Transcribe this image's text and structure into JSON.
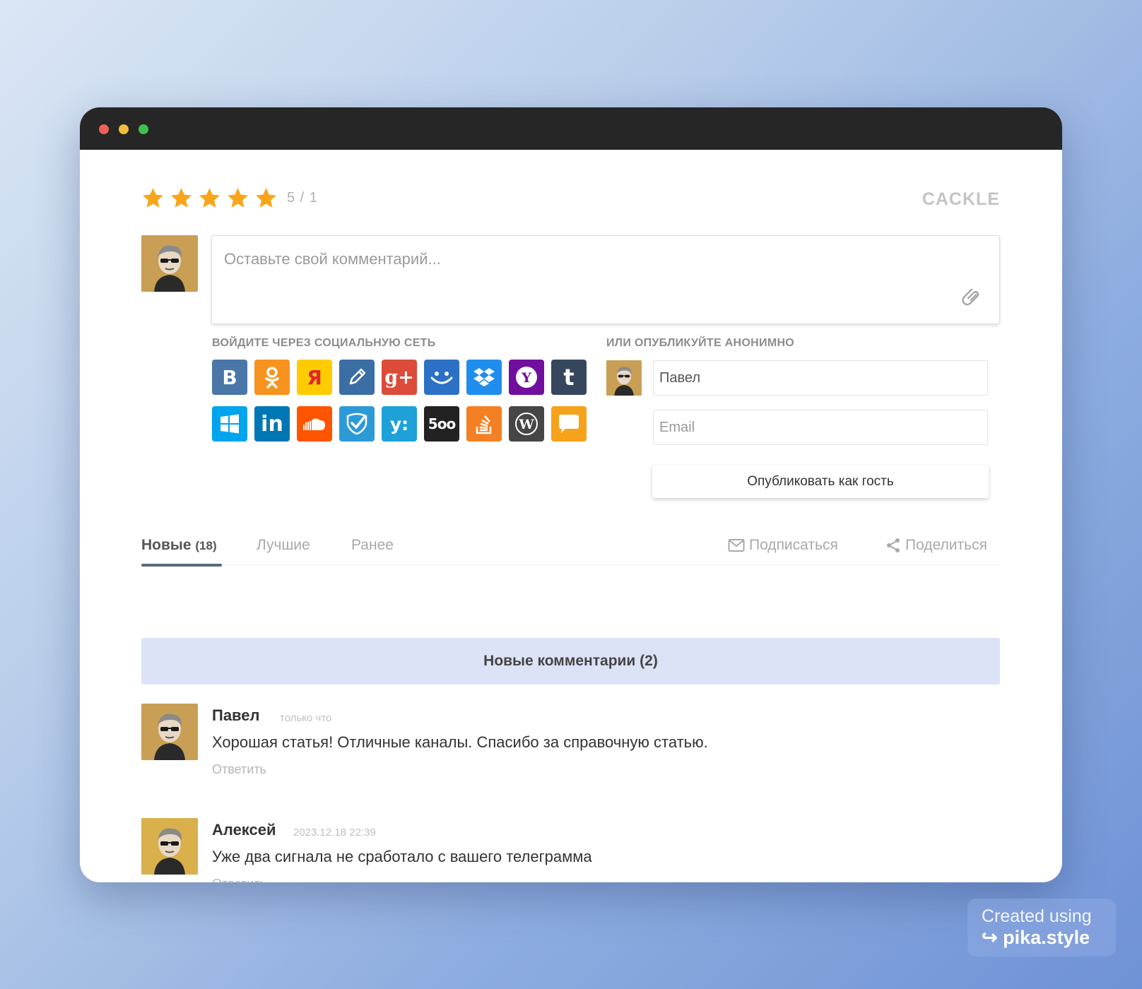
{
  "rating": {
    "stars": 5,
    "max": 5,
    "text": "5 / 1"
  },
  "brand": "CACKLE",
  "comment_box": {
    "placeholder": "Оставьте свой комментарий..."
  },
  "social_login": {
    "label": "ВОЙДИТЕ ЧЕРЕЗ СОЦИАЛЬНУЮ СЕТЬ",
    "networks": [
      {
        "name": "vkontakte",
        "glyph": "B",
        "color": "#4a76a8"
      },
      {
        "name": "odnoklassniki",
        "glyph": "ok",
        "color": "#f7931e"
      },
      {
        "name": "yandex",
        "glyph": "Я",
        "color": "#ffcc00"
      },
      {
        "name": "livejournal",
        "glyph": "pencil",
        "color": "#3b6ea5"
      },
      {
        "name": "google-plus",
        "glyph": "g+",
        "color": "#dd4b39"
      },
      {
        "name": "mail-ru",
        "glyph": "smile",
        "color": "#2d71c6"
      },
      {
        "name": "dropbox",
        "glyph": "box",
        "color": "#1f8ded"
      },
      {
        "name": "yahoo",
        "glyph": "Y",
        "color": "#720e9e"
      },
      {
        "name": "tumblr",
        "glyph": "t",
        "color": "#36465d"
      },
      {
        "name": "windows",
        "glyph": "win",
        "color": "#00a4ef"
      },
      {
        "name": "linkedin",
        "glyph": "in",
        "color": "#0077b5"
      },
      {
        "name": "soundcloud",
        "glyph": "cloud",
        "color": "#ff5500"
      },
      {
        "name": "foursquare",
        "glyph": "check",
        "color": "#2d9ad8"
      },
      {
        "name": "yammer",
        "glyph": "y:",
        "color": "#1da1d8"
      },
      {
        "name": "500px",
        "glyph": "500",
        "color": "#222222"
      },
      {
        "name": "stackoverflow",
        "glyph": "so",
        "color": "#f48024"
      },
      {
        "name": "wordpress",
        "glyph": "W",
        "color": "#464646"
      },
      {
        "name": "message",
        "glyph": "bubble",
        "color": "#f7a21b"
      }
    ]
  },
  "guest": {
    "label": "ИЛИ ОПУБЛИКУЙТЕ АНОНИМНО",
    "name_value": "Павел",
    "email_placeholder": "Email",
    "publish_label": "Опубликовать как гость"
  },
  "tabs": {
    "new_label": "Новые",
    "new_count": "(18)",
    "best_label": "Лучшие",
    "earlier_label": "Ранее",
    "subscribe_label": "Подписаться",
    "share_label": "Поделиться"
  },
  "new_comments_banner": "Новые комментарии (2)",
  "comments": [
    {
      "author": "Павел",
      "time": "только что",
      "text": "Хорошая статья! Отличные каналы. Спасибо за справочную статью.",
      "reply_label": "Ответить"
    },
    {
      "author": "Алексей",
      "time": "2023.12.18 22:39",
      "text": "Уже два сигнала не сработало с вашего телеграмма",
      "reply_label": "Ответить"
    }
  ],
  "watermark": {
    "line1": "Created using",
    "line2": "pika.style"
  }
}
